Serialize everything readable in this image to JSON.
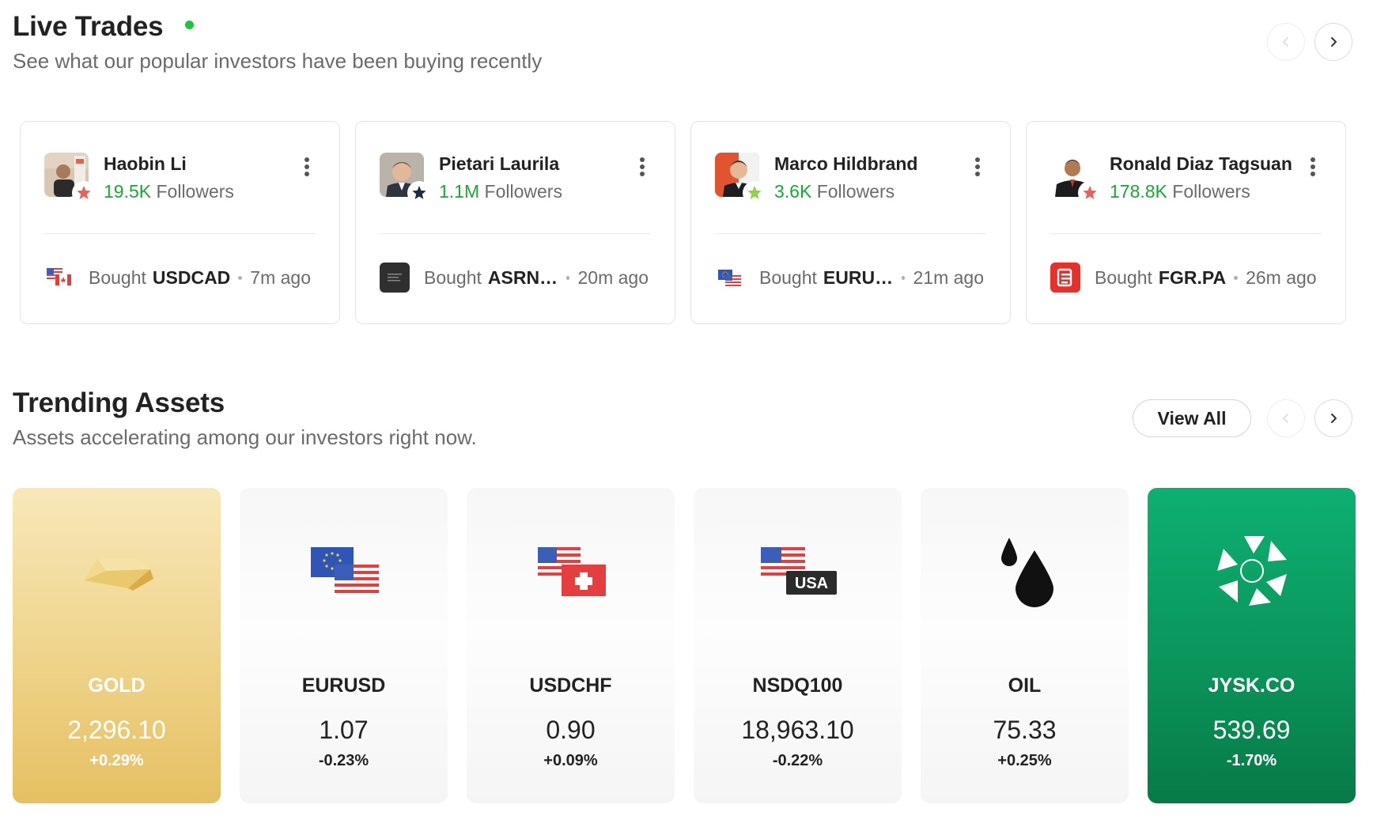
{
  "live_trades": {
    "title": "Live Trades",
    "subtitle": "See what our popular investors have been buying recently",
    "cards": [
      {
        "name": "Haobin Li",
        "followers_count": "19.5K",
        "followers_label": "Followers",
        "action": "Bought",
        "symbol": "USDCAD",
        "time": "7m ago",
        "badge_color": "#e9615a",
        "asset_icon": "usd-cad-flags-icon"
      },
      {
        "name": "Pietari Laurila",
        "followers_count": "1.1M",
        "followers_label": "Followers",
        "action": "Bought",
        "symbol": "ASRNL...",
        "time": "20m ago",
        "badge_color": "#1e2a44",
        "asset_icon": "asrnl-logo-icon"
      },
      {
        "name": "Marco Hildbrand",
        "followers_count": "3.6K",
        "followers_label": "Followers",
        "action": "Bought",
        "symbol": "EURUSD",
        "time": "21m ago",
        "badge_color": "#8fd14f",
        "asset_icon": "eur-usd-flags-icon"
      },
      {
        "name": "Ronald Diaz Tagsuan",
        "followers_count": "178.8K",
        "followers_label": "Followers",
        "action": "Bought",
        "symbol": "FGR.PA",
        "time": "26m ago",
        "badge_color": "#e9615a",
        "asset_icon": "fgr-logo-icon"
      }
    ]
  },
  "trending_assets": {
    "title": "Trending Assets",
    "subtitle": "Assets accelerating among our investors right now.",
    "view_all_label": "View All",
    "assets": [
      {
        "name": "GOLD",
        "price": "2,296.10",
        "change": "+0.29%",
        "icon": "gold-bar-icon"
      },
      {
        "name": "EURUSD",
        "price": "1.07",
        "change": "-0.23%",
        "icon": "eur-usd-flags-icon"
      },
      {
        "name": "USDCHF",
        "price": "0.90",
        "change": "+0.09%",
        "icon": "usd-chf-flags-icon"
      },
      {
        "name": "NSDQ100",
        "price": "18,963.10",
        "change": "-0.22%",
        "icon": "usa-flag-icon"
      },
      {
        "name": "OIL",
        "price": "75.33",
        "change": "+0.25%",
        "icon": "oil-drops-icon"
      },
      {
        "name": "JYSK.CO",
        "price": "539.69",
        "change": "-1.70%",
        "icon": "jyske-logo-icon"
      }
    ],
    "usa_label": "USA"
  },
  "colors": {
    "live_dot": "#1cc63a",
    "followers_green": "#17a838",
    "gold_card": "#eed389",
    "green_card": "#0a955b"
  }
}
